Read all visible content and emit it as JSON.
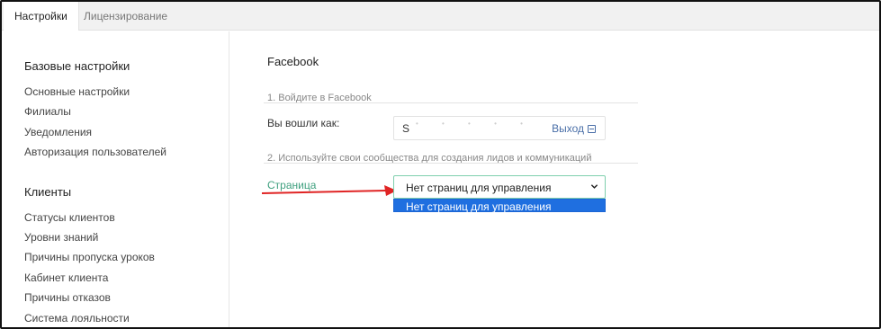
{
  "tabs": [
    {
      "label": "Настройки",
      "active": true
    },
    {
      "label": "Лицензирование",
      "active": false
    }
  ],
  "sidebar": {
    "groups": [
      {
        "title": "Базовые настройки",
        "items": [
          "Основные настройки",
          "Филиалы",
          "Уведомления",
          "Авторизация пользователей"
        ]
      },
      {
        "title": "Клиенты",
        "items": [
          "Статусы клиентов",
          "Уровни знаний",
          "Причины пропуска уроков",
          "Кабинет клиента",
          "Причины отказов",
          "Система лояльности"
        ]
      }
    ]
  },
  "main": {
    "title": "Facebook",
    "step1": "1. Войдите в Facebook",
    "logged_in_label": "Вы вошли как:",
    "account_initial": "S",
    "account_masked": "• • • • •",
    "logout_label": "Выход",
    "step2": "2. Используйте свои сообщества для создания лидов и коммуникаций",
    "page_label": "Страница",
    "select_value": "Нет страниц для управления",
    "dropdown_options": [
      "Нет страниц для управления"
    ]
  },
  "colors": {
    "accent_green": "#3fa07f",
    "link_blue": "#4a6fa8",
    "selection_blue": "#1f6fe0",
    "arrow_red": "#e02424"
  }
}
